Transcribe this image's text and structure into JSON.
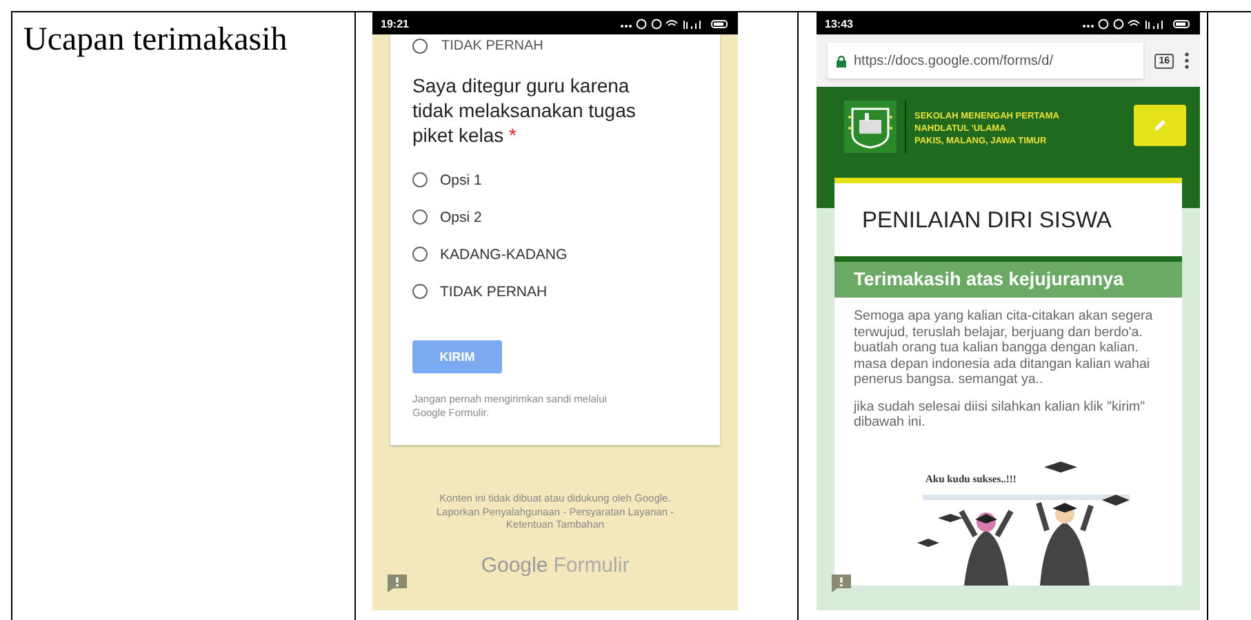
{
  "label_cell": {
    "text": "Ucapan terimakasih"
  },
  "screens": [
    {
      "kind": "form",
      "status_time": "19:21",
      "cut_option": {
        "label": "TIDAK PERNAH",
        "selected": false
      },
      "question": "Saya ditegur guru karena tidak melaksanakan tugas piket kelas",
      "required_mark": "*",
      "options": [
        {
          "label": "Opsi 1",
          "selected": false
        },
        {
          "label": "Opsi 2",
          "selected": false
        },
        {
          "label": "KADANG-KADANG",
          "selected": false
        },
        {
          "label": "TIDAK PERNAH",
          "selected": false
        }
      ],
      "submit": "KIRIM",
      "password_note": "Jangan pernah mengirimkan sandi melalui Google Formulir.",
      "footer": [
        "Konten ini tidak dibuat atau didukung oleh Google.",
        "Laporkan Penyalahgunaan - Persyaratan Layanan - Ketentuan Tambahan"
      ],
      "brand": [
        "Google",
        "Formulir"
      ]
    },
    {
      "kind": "thanks",
      "status_time": "13:43",
      "url": "https://docs.google.com/forms/d/",
      "tab_count": "16",
      "school": [
        "SEKOLAH MENENGAH PERTAMA",
        "NAHDLATUL 'ULAMA",
        "PAKIS, MALANG, JAWA TIMUR"
      ],
      "title": "PENILAIAN DIRI SISWA",
      "section": "Terimakasih atas kejujurannya",
      "paragraphs": [
        "Semoga apa yang kalian cita-citakan akan segera terwujud, teruslah belajar, berjuang dan berdo'a. buatlah orang tua kalian bangga dengan kalian. masa depan indonesia ada ditangan kalian wahai penerus bangsa. semangat ya..",
        "jika sudah selesai diisi silahkan kalian klik \"kirim\" dibawah ini."
      ],
      "illustration_caption": "Aku kudu sukses..!!!"
    }
  ]
}
